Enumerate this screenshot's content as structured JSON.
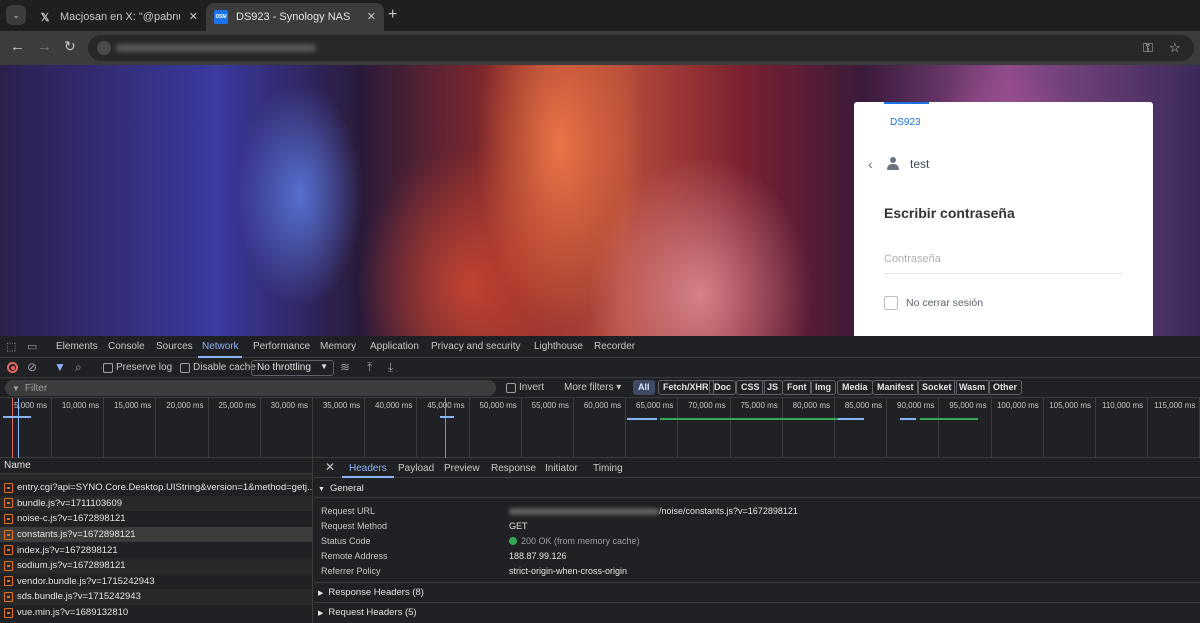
{
  "browser": {
    "tabs": [
      {
        "title": "Macjosan en X: \"@pabnull Es la",
        "favicon": "x-logo-icon"
      },
      {
        "title": "DS923 - Synology NAS",
        "favicon": "dsm-icon",
        "favicon_text": "DSM"
      }
    ],
    "new_tab_symbol": "+",
    "close_symbol": "✕"
  },
  "login": {
    "brand": "DS923",
    "username": "test",
    "heading": "Escribir contraseña",
    "password_placeholder": "Contraseña",
    "remember_label": "No cerrar sesión"
  },
  "devtools": {
    "panels": [
      "Elements",
      "Console",
      "Sources",
      "Network",
      "Performance",
      "Memory",
      "Application",
      "Privacy and security",
      "Lighthouse",
      "Recorder"
    ],
    "active_panel": "Network",
    "network_toolbar": {
      "preserve_log": "Preserve log",
      "disable_cache": "Disable cache",
      "throttling": "No throttling"
    },
    "filter": {
      "placeholder": "Filter",
      "invert": "Invert",
      "more_filters": "More filters",
      "types": [
        "All",
        "Fetch/XHR",
        "Doc",
        "CSS",
        "JS",
        "Font",
        "Img",
        "Media",
        "Manifest",
        "Socket",
        "Wasm",
        "Other"
      ]
    },
    "timeline_ticks": [
      "5,000 ms",
      "10,000 ms",
      "15,000 ms",
      "20,000 ms",
      "25,000 ms",
      "30,000 ms",
      "35,000 ms",
      "40,000 ms",
      "45,000 ms",
      "50,000 ms",
      "55,000 ms",
      "60,000 ms",
      "65,000 ms",
      "70,000 ms",
      "75,000 ms",
      "80,000 ms",
      "85,000 ms",
      "90,000 ms",
      "95,000 ms",
      "100,000 ms",
      "105,000 ms",
      "110,000 ms",
      "115,000 ms"
    ],
    "requests": {
      "column": "Name",
      "rows": [
        "entry.cgi?api=SYNO.Core.Desktop.UIString&version=1&method=getj...",
        "bundle.js?v=1711103609",
        "noise-c.js?v=1672898121",
        "constants.js?v=1672898121",
        "index.js?v=1672898121",
        "sodium.js?v=1672898121",
        "vendor.bundle.js?v=1715242943",
        "sds.bundle.js?v=1715242943",
        "vue.min.js?v=1689132810"
      ],
      "selected_index": 3
    },
    "detail": {
      "tabs": [
        "Headers",
        "Payload",
        "Preview",
        "Response",
        "Initiator",
        "Timing"
      ],
      "active_tab": "Headers",
      "general_title": "General",
      "general": {
        "request_url_key": "Request URL",
        "request_url_value": "/noise/constants.js?v=1672898121",
        "request_method_key": "Request Method",
        "request_method_value": "GET",
        "status_code_key": "Status Code",
        "status_code_value": "200 OK",
        "status_code_note": "(from memory cache)",
        "remote_address_key": "Remote Address",
        "remote_address_value": "188.87.99.126",
        "referrer_policy_key": "Referrer Policy",
        "referrer_policy_value": "strict-origin-when-cross-origin"
      },
      "response_headers": "Response Headers (8)",
      "request_headers": "Request Headers (5)"
    }
  }
}
